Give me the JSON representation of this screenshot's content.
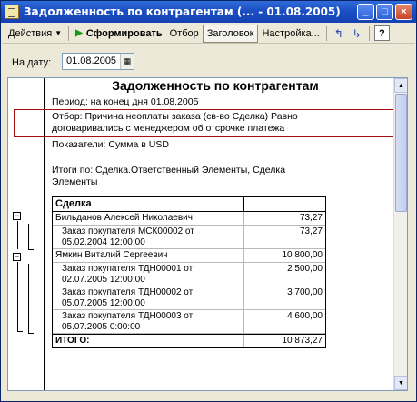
{
  "window": {
    "title": "Задолженность по контрагентам (... - 01.08.2005)",
    "buttons": {
      "minimize": "_",
      "maximize": "□",
      "close": "×"
    }
  },
  "toolbar": {
    "actions": "Действия",
    "generate": "Сформировать",
    "filter": "Отбор",
    "header": "Заголовок",
    "settings": "Настройка...",
    "help": "?"
  },
  "date": {
    "label": "На дату:",
    "value": "01.08.2005"
  },
  "report": {
    "title": "Задолженность по контрагентам",
    "period": "Период: на конец дня 01.08.2005",
    "filter_line1": "Отбор: Причина неоплаты заказа (св-во Сделка) Равно",
    "filter_line2": "договаривались с менеджером об отсрочке платежа",
    "indicators": "Показатели:  Сумма в USD",
    "totals_line1": "Итоги по:  Сделка.Ответственный Элементы, Сделка",
    "totals_line2": "Элементы",
    "table": {
      "header": "Сделка",
      "rows": [
        {
          "label": "Бильданов Алексей Николаевич",
          "value": "73,27",
          "type": "single"
        },
        {
          "label1": "Заказ покупателя МСК00002 от",
          "label2": "05.02.2004 12:00:00",
          "value": "73,27",
          "type": "double"
        },
        {
          "label": "Ямкин Виталий Сергеевич",
          "value": "10 800,00",
          "type": "single"
        },
        {
          "label1": "Заказ покупателя ТДН00001 от",
          "label2": "02.07.2005 12:00:00",
          "value": "2 500,00",
          "type": "double"
        },
        {
          "label1": "Заказ покупателя ТДН00002 от",
          "label2": "05.07.2005 12:00:00",
          "value": "3 700,00",
          "type": "double"
        },
        {
          "label1": "Заказ покупателя ТДН00003 от",
          "label2": "05.07.2005 0:00:00",
          "value": "4 600,00",
          "type": "double"
        }
      ],
      "total": {
        "label": "ИТОГО:",
        "value": "10 873,27"
      }
    },
    "group_toggle": "−"
  },
  "colors": {
    "titlebar": "#1c4fc4",
    "filter_highlight": "#a01010",
    "toolbar_bg": "#ece9d8"
  }
}
